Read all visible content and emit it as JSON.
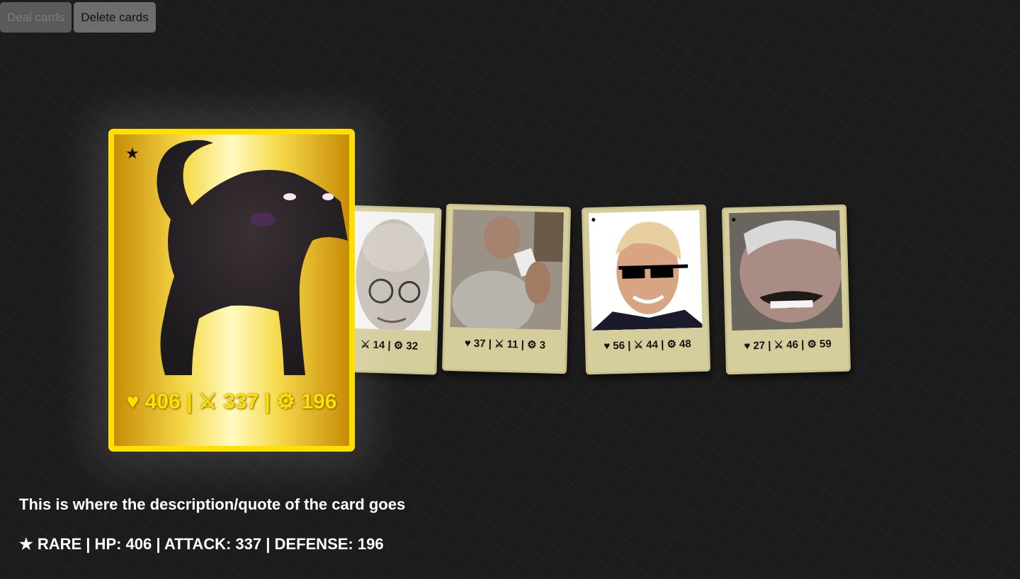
{
  "toolbar": {
    "deal_label": "Deal cards",
    "delete_label": "Delete cards"
  },
  "featured_card": {
    "rarity_icon": "★",
    "stats_text": "♥ 406 | ⚔ 337 | ⚙ 196",
    "gradient": [
      "#c88c06",
      "#fffbc0"
    ],
    "border_color": "#ffe000"
  },
  "hand": [
    {
      "stats_text": "⚔ 14 | ⚙ 32"
    },
    {
      "stats_text": "♥ 37 | ⚔ 11 | ⚙ 3"
    },
    {
      "stats_text": "♥ 56 | ⚔ 44 | ⚙ 48"
    },
    {
      "stats_text": "♥ 27 | ⚔ 46 | ⚙ 59"
    }
  ],
  "description": "This is where the description/quote of the card goes",
  "summary": "★ RARE | HP: 406 | ATTACK: 337 | DEFENSE: 196"
}
